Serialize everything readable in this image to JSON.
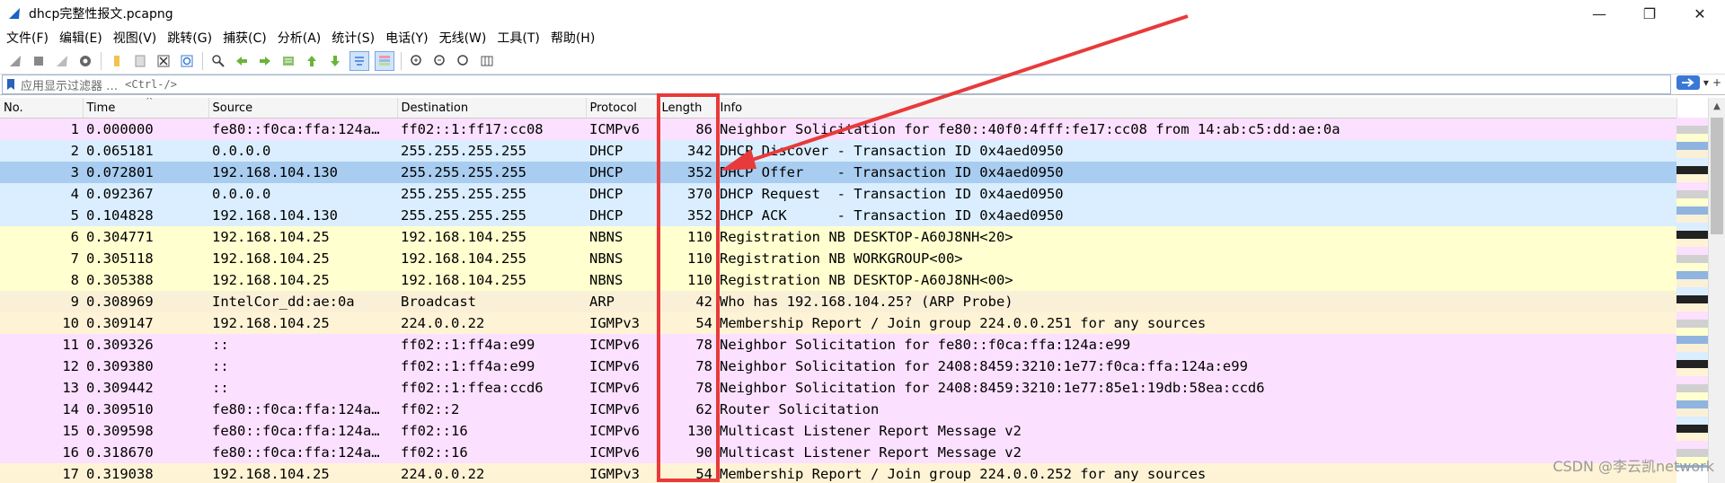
{
  "window": {
    "title": "dhcp完整性报文.pcapng",
    "minimize": "—",
    "maximize": "❐",
    "close": "✕"
  },
  "menu": [
    "文件(F)",
    "编辑(E)",
    "视图(V)",
    "跳转(G)",
    "捕获(C)",
    "分析(A)",
    "统计(S)",
    "电话(Y)",
    "无线(W)",
    "工具(T)",
    "帮助(H)"
  ],
  "toolbar": {
    "icons": [
      "shark-fin-start-icon",
      "stop-capture-icon",
      "restart-capture-icon",
      "capture-options-icon",
      "open-file-icon",
      "save-file-icon",
      "close-file-icon",
      "reload-file-icon",
      "find-packet-icon",
      "go-back-icon",
      "go-forward-icon",
      "go-to-packet-icon",
      "first-packet-icon",
      "last-packet-icon",
      "auto-scroll-icon",
      "colorize-icon",
      "zoom-in-icon",
      "zoom-out-icon",
      "zoom-normal-icon",
      "resize-columns-icon"
    ]
  },
  "filter": {
    "placeholder": "应用显示过滤器 …",
    "shortcut": "<Ctrl-/>",
    "plus": "+"
  },
  "columns": [
    "No.",
    "Time",
    "Source",
    "Destination",
    "Protocol",
    "Length",
    "Info"
  ],
  "rows": [
    {
      "no": "1",
      "time": "0.000000",
      "src": "fe80::f0ca:ffa:124a…",
      "dst": "ff02::1:ff17:cc08",
      "proto": "ICMPv6",
      "len": "86",
      "info": "Neighbor Solicitation for fe80::40f0:4fff:fe17:cc08 from 14:ab:c5:dd:ae:0a",
      "bg": "#fce0ff"
    },
    {
      "no": "2",
      "time": "0.065181",
      "src": "0.0.0.0",
      "dst": "255.255.255.255",
      "proto": "DHCP",
      "len": "342",
      "info": "DHCP Discover - Transaction ID 0x4aed0950",
      "bg": "#daeeff"
    },
    {
      "no": "3",
      "time": "0.072801",
      "src": "192.168.104.130",
      "dst": "255.255.255.255",
      "proto": "DHCP",
      "len": "352",
      "info": "DHCP Offer    - Transaction ID 0x4aed0950",
      "bg": "#a9cdf0"
    },
    {
      "no": "4",
      "time": "0.092367",
      "src": "0.0.0.0",
      "dst": "255.255.255.255",
      "proto": "DHCP",
      "len": "370",
      "info": "DHCP Request  - Transaction ID 0x4aed0950",
      "bg": "#daeeff"
    },
    {
      "no": "5",
      "time": "0.104828",
      "src": "192.168.104.130",
      "dst": "255.255.255.255",
      "proto": "DHCP",
      "len": "352",
      "info": "DHCP ACK      - Transaction ID 0x4aed0950",
      "bg": "#daeeff"
    },
    {
      "no": "6",
      "time": "0.304771",
      "src": "192.168.104.25",
      "dst": "192.168.104.255",
      "proto": "NBNS",
      "len": "110",
      "info": "Registration NB DESKTOP-A60J8NH<20>",
      "bg": "#ffffd0"
    },
    {
      "no": "7",
      "time": "0.305118",
      "src": "192.168.104.25",
      "dst": "192.168.104.255",
      "proto": "NBNS",
      "len": "110",
      "info": "Registration NB WORKGROUP<00>",
      "bg": "#ffffd0"
    },
    {
      "no": "8",
      "time": "0.305388",
      "src": "192.168.104.25",
      "dst": "192.168.104.255",
      "proto": "NBNS",
      "len": "110",
      "info": "Registration NB DESKTOP-A60J8NH<00>",
      "bg": "#ffffd0"
    },
    {
      "no": "9",
      "time": "0.308969",
      "src": "IntelCor_dd:ae:0a",
      "dst": "Broadcast",
      "proto": "ARP",
      "len": "42",
      "info": "Who has 192.168.104.25? (ARP Probe)",
      "bg": "#faf0d7"
    },
    {
      "no": "10",
      "time": "0.309147",
      "src": "192.168.104.25",
      "dst": "224.0.0.22",
      "proto": "IGMPv3",
      "len": "54",
      "info": "Membership Report / Join group 224.0.0.251 for any sources",
      "bg": "#fff3d6"
    },
    {
      "no": "11",
      "time": "0.309326",
      "src": "::",
      "dst": "ff02::1:ff4a:e99",
      "proto": "ICMPv6",
      "len": "78",
      "info": "Neighbor Solicitation for fe80::f0ca:ffa:124a:e99",
      "bg": "#fce0ff"
    },
    {
      "no": "12",
      "time": "0.309380",
      "src": "::",
      "dst": "ff02::1:ff4a:e99",
      "proto": "ICMPv6",
      "len": "78",
      "info": "Neighbor Solicitation for 2408:8459:3210:1e77:f0ca:ffa:124a:e99",
      "bg": "#fce0ff"
    },
    {
      "no": "13",
      "time": "0.309442",
      "src": "::",
      "dst": "ff02::1:ffea:ccd6",
      "proto": "ICMPv6",
      "len": "78",
      "info": "Neighbor Solicitation for 2408:8459:3210:1e77:85e1:19db:58ea:ccd6",
      "bg": "#fce0ff"
    },
    {
      "no": "14",
      "time": "0.309510",
      "src": "fe80::f0ca:ffa:124a…",
      "dst": "ff02::2",
      "proto": "ICMPv6",
      "len": "62",
      "info": "Router Solicitation",
      "bg": "#fce0ff"
    },
    {
      "no": "15",
      "time": "0.309598",
      "src": "fe80::f0ca:ffa:124a…",
      "dst": "ff02::16",
      "proto": "ICMPv6",
      "len": "130",
      "info": "Multicast Listener Report Message v2",
      "bg": "#fce0ff"
    },
    {
      "no": "16",
      "time": "0.318670",
      "src": "fe80::f0ca:ffa:124a…",
      "dst": "ff02::16",
      "proto": "ICMPv6",
      "len": "90",
      "info": "Multicast Listener Report Message v2",
      "bg": "#fce0ff"
    },
    {
      "no": "17",
      "time": "0.319038",
      "src": "192.168.104.25",
      "dst": "224.0.0.22",
      "proto": "IGMPv3",
      "len": "54",
      "info": "Membership Report / Join group 224.0.0.252 for any sources",
      "bg": "#fff3d6"
    }
  ],
  "selected_row": 3,
  "annotation_color": "#e83a3a",
  "watermark": "CSDN @李云凯network"
}
